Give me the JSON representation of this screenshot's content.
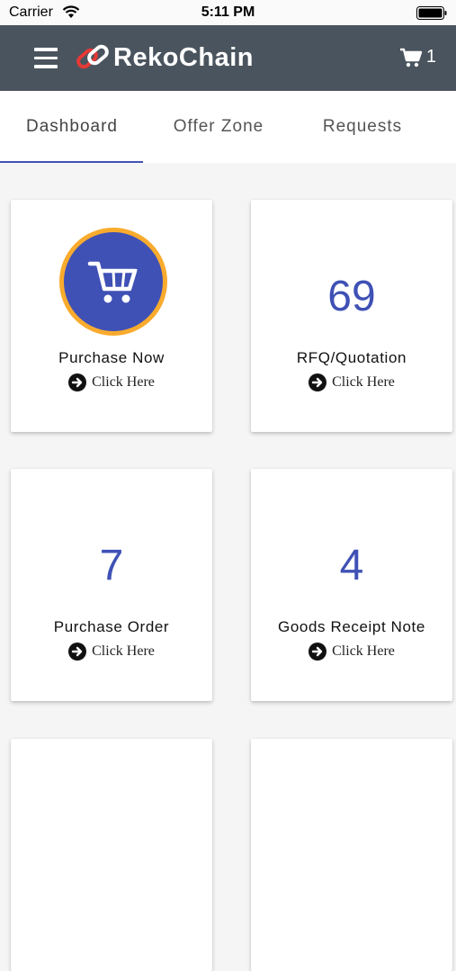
{
  "status_bar": {
    "carrier": "Carrier",
    "time": "5:11 PM",
    "wifi_icon": "wifi-icon",
    "battery_icon": "battery-icon"
  },
  "app_bar": {
    "menu_icon": "hamburger-menu-icon",
    "logo_text": "RekoChain",
    "cart_icon": "shopping-cart-icon",
    "cart_count": "1",
    "background_color": "#4a545e"
  },
  "tabs": [
    {
      "label": "Dashboard",
      "active": true
    },
    {
      "label": "Offer Zone",
      "active": false
    },
    {
      "label": "Requests",
      "active": false
    }
  ],
  "cards": [
    {
      "title": "Purchase Now",
      "icon": "shopping-cart-icon",
      "link_label": "Click Here"
    },
    {
      "title": "RFQ/Quotation",
      "count": "69",
      "link_label": "Click Here"
    },
    {
      "title": "Purchase Order",
      "count": "7",
      "link_label": "Click Here"
    },
    {
      "title": "Goods Receipt Note",
      "count": "4",
      "link_label": "Click Here"
    }
  ],
  "colors": {
    "accent": "#3f51b5",
    "badge_ring": "#f9ab2e",
    "logo_mark": "#e53935"
  }
}
